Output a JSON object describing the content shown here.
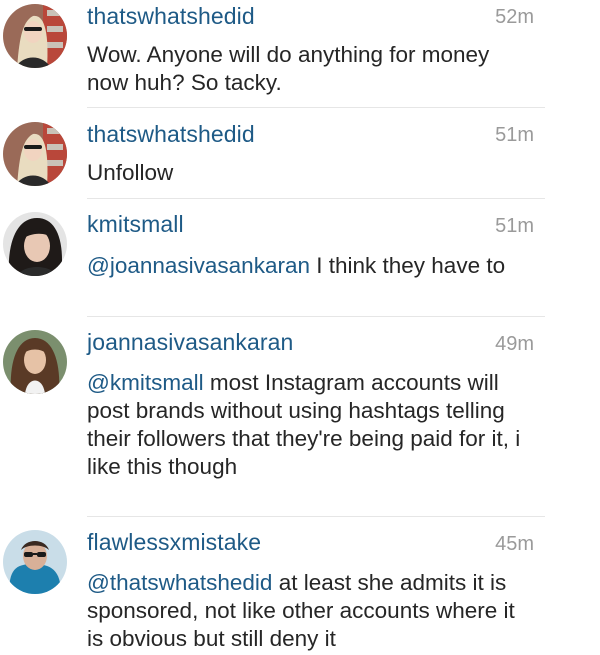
{
  "comments": [
    {
      "username": "thatswhatshedid",
      "time": "52m",
      "mention": "",
      "text": "Wow. Anyone will do anything for money now huh? So tacky.",
      "avatar": "blonde-user-avatar"
    },
    {
      "username": "thatswhatshedid",
      "time": "51m",
      "mention": "",
      "text": "Unfollow",
      "avatar": "blonde-user-avatar"
    },
    {
      "username": "kmitsmall",
      "time": "51m",
      "mention": "@joannasivasankaran",
      "text": " I think they have to",
      "avatar": "dark-hair-user-avatar"
    },
    {
      "username": "joannasivasankaran",
      "time": "49m",
      "mention": "@kmitsmall",
      "text": " most Instagram accounts will post brands without using hashtags telling their followers that they're being paid for it, i like this though",
      "avatar": "brunette-user-avatar"
    },
    {
      "username": "flawlessxmistake",
      "time": "45m",
      "mention": "@thatswhatshedid",
      "text": " at least she admits it is sponsored, not like other accounts where it is obvious but still deny it",
      "avatar": "sunglasses-user-avatar"
    }
  ]
}
